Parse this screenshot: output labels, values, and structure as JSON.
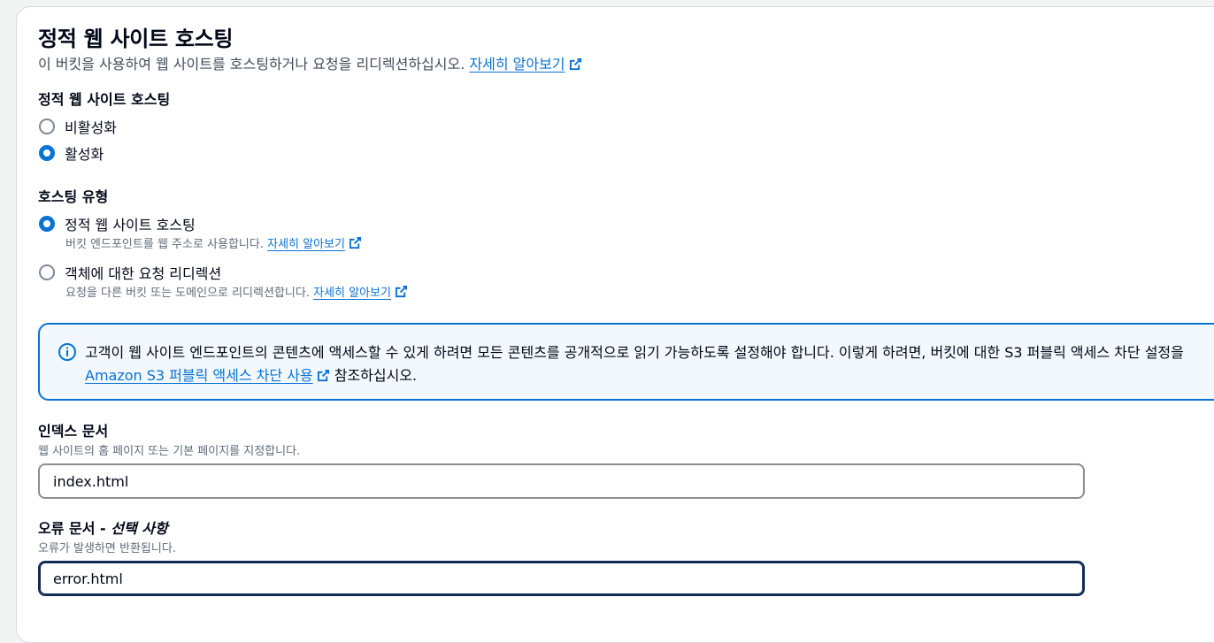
{
  "section": {
    "title": "정적 웹 사이트 호스팅",
    "description": "이 버킷을 사용하여 웹 사이트를 호스팅하거나 요청을 리디렉션하십시오.",
    "learn_more": "자세히 알아보기"
  },
  "hosting_toggle": {
    "label": "정적 웹 사이트 호스팅",
    "options": [
      {
        "label": "비활성화",
        "checked": false
      },
      {
        "label": "활성화",
        "checked": true
      }
    ]
  },
  "hosting_type": {
    "label": "호스팅 유형",
    "options": [
      {
        "label": "정적 웹 사이트 호스팅",
        "description": "버킷 엔드포인트를 웹 주소로 사용합니다.",
        "link": "자세히 알아보기",
        "checked": true
      },
      {
        "label": "객체에 대한 요청 리디렉션",
        "description": "요청을 다른 버킷 또는 도메인으로 리디렉션합니다.",
        "link": "자세히 알아보기",
        "checked": false
      }
    ]
  },
  "info_alert": {
    "line1": "고객이 웹 사이트 엔드포인트의 콘텐츠에 액세스할 수 있게 하려면 모든 콘텐츠를 공개적으로 읽기 가능하도록 설정해야 합니다. 이렇게 하려면, 버킷에 대한 S3 퍼블릭 액세스 차단 설정을",
    "link": "Amazon S3 퍼블릭 액세스 차단 사용",
    "suffix": "참조하십시오."
  },
  "index_document": {
    "label": "인덱스 문서",
    "hint": "웹 사이트의 홈 페이지 또는 기본 페이지를 지정합니다.",
    "value": "index.html"
  },
  "error_document": {
    "label": "오류 문서 -",
    "optional": "선택 사항",
    "hint": "오류가 발생하면 반환됩니다.",
    "value": "error.html"
  },
  "colors": {
    "link": "#0972d3",
    "radio_checked": "#0972d3",
    "info_border": "#0972d3",
    "focus_border": "#0f2c52"
  }
}
